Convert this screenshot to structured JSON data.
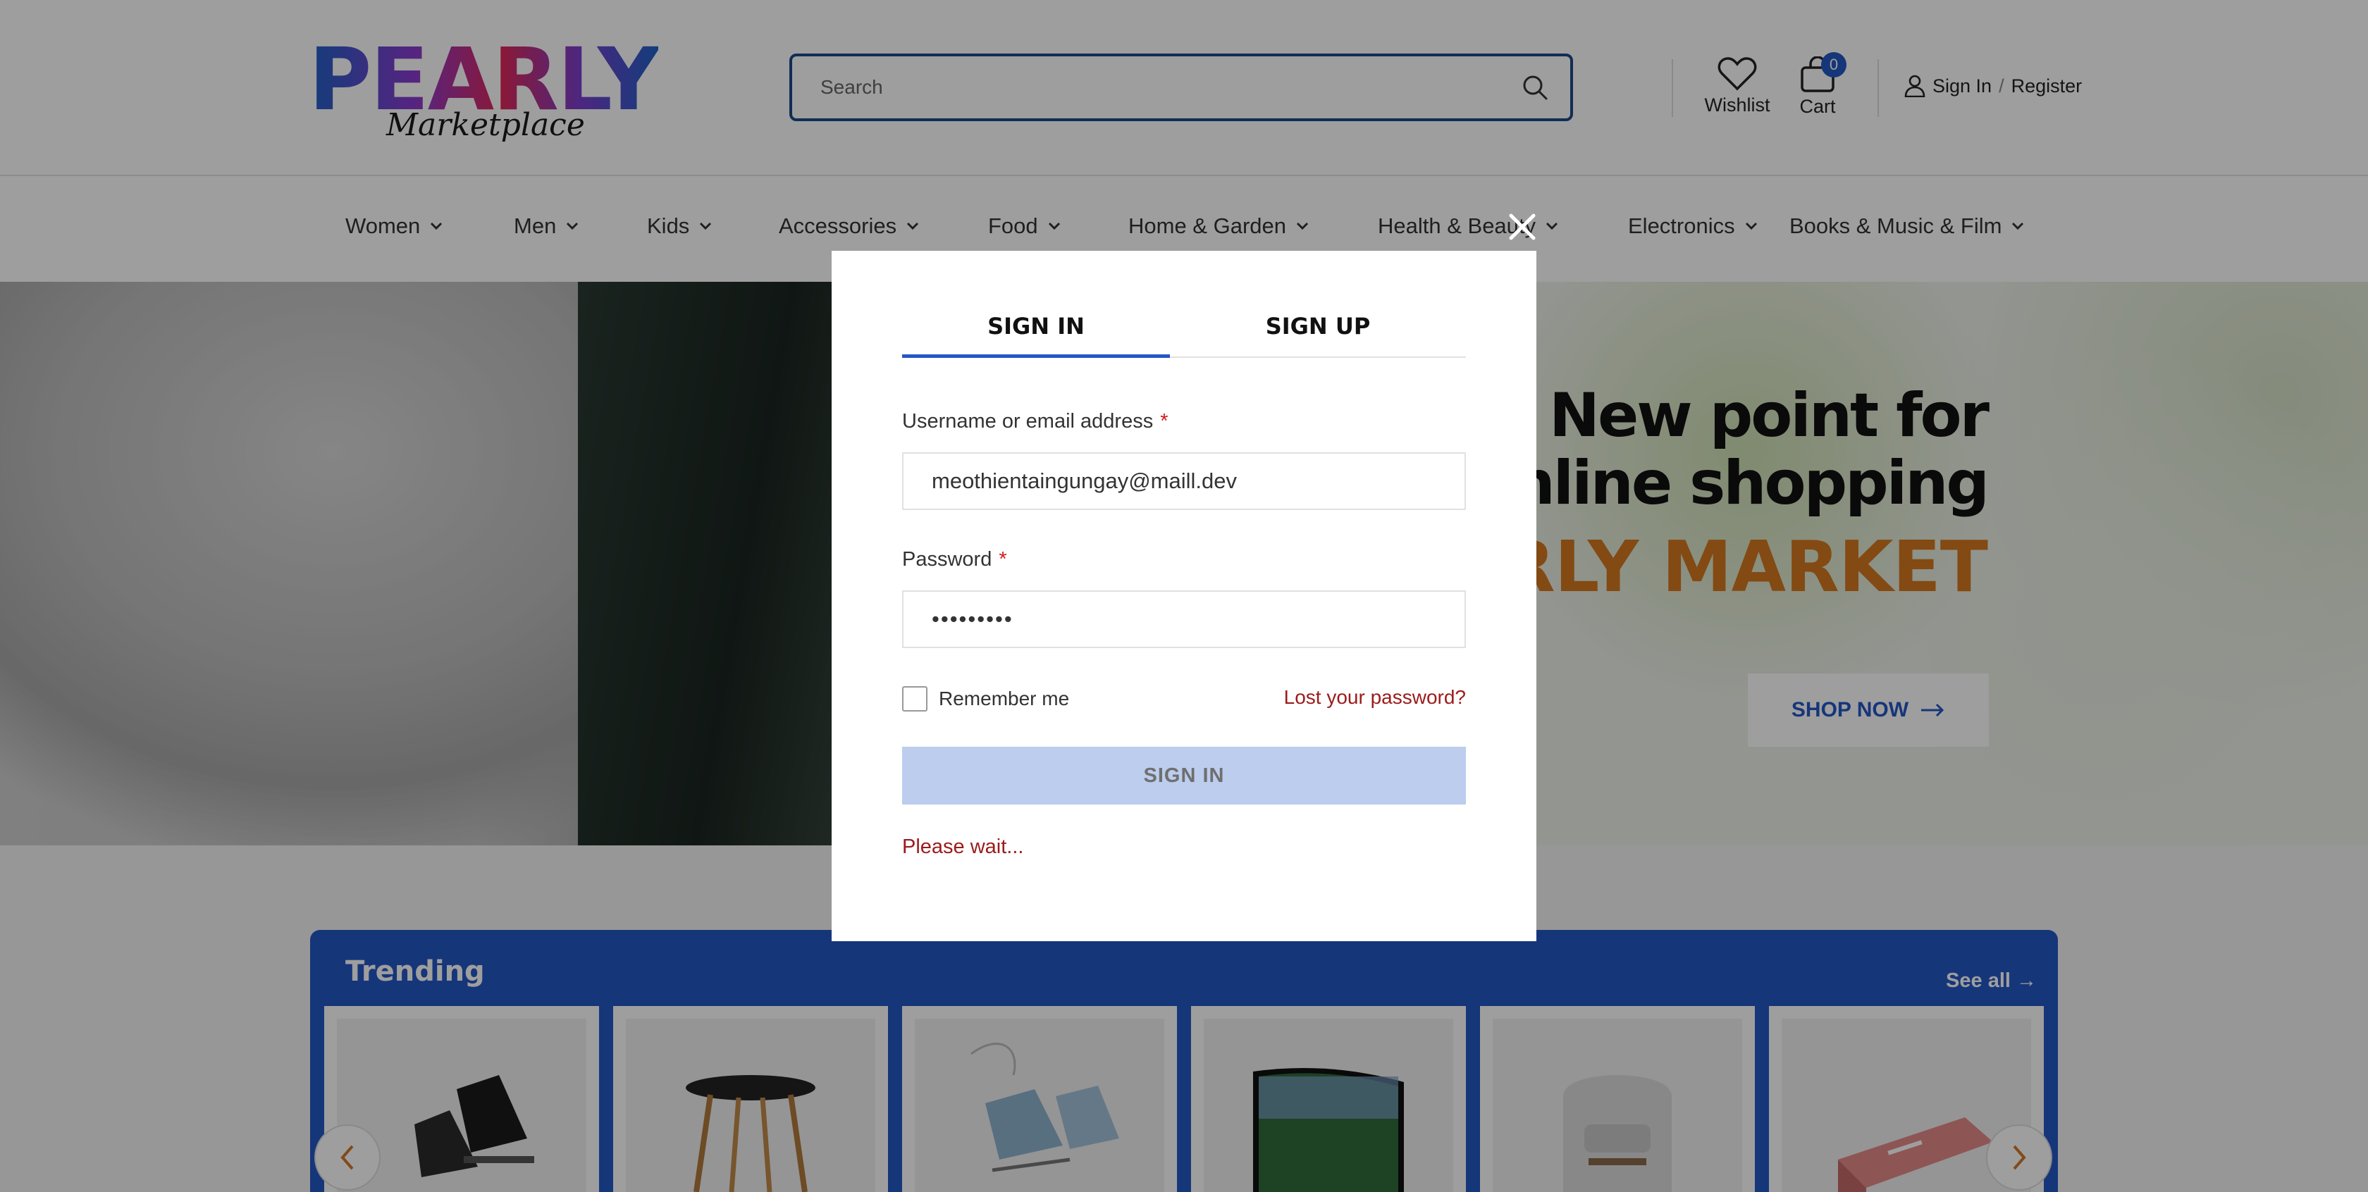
{
  "header": {
    "logo_main": "PEARLY",
    "logo_sub": "Marketplace",
    "search_placeholder": "Search",
    "wishlist_label": "Wishlist",
    "cart_label": "Cart",
    "cart_count": "0",
    "signin_label": "Sign In",
    "signin_sep": "/",
    "register_label": "Register"
  },
  "nav": {
    "items": [
      {
        "label": "Women"
      },
      {
        "label": "Men"
      },
      {
        "label": "Kids"
      },
      {
        "label": "Accessories"
      },
      {
        "label": "Food"
      },
      {
        "label": "Home & Garden"
      },
      {
        "label": "Health & Beauty"
      },
      {
        "label": "Electronics"
      },
      {
        "label": "Books & Music & Film"
      }
    ]
  },
  "hero": {
    "line1": "New point for",
    "line2": "online shopping",
    "line3": "PEARLY MARKET",
    "button_label": "SHOP NOW"
  },
  "trending": {
    "title": "Trending",
    "see_all_label": "See all",
    "products": [
      {
        "icon": "hockey-skates"
      },
      {
        "icon": "side-table"
      },
      {
        "icon": "ice-skates"
      },
      {
        "icon": "television"
      },
      {
        "icon": "armchair"
      },
      {
        "icon": "power-bank"
      }
    ]
  },
  "modal": {
    "tab_signin": "SIGN IN",
    "tab_signup": "SIGN UP",
    "username_label": "Username or email address",
    "username_value": "meothientaingungay@maill.dev",
    "password_label": "Password",
    "password_value": "•••••••••",
    "required_mark": "*",
    "remember_label": "Remember me",
    "lost_password_label": "Lost your password?",
    "submit_label": "SIGN IN",
    "status_message": "Please wait..."
  },
  "colors": {
    "accent": "#2457c5",
    "hero_highlight": "#d4781f",
    "error_text": "#9b1b1b",
    "submit_disabled": "#bccdee"
  }
}
